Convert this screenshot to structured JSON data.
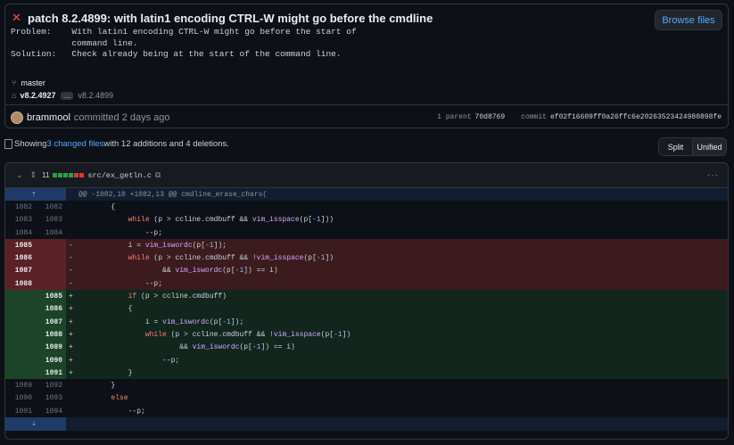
{
  "commit": {
    "title": "patch 8.2.4899: with latin1 encoding CTRL-W might go before the cmdline",
    "browse_label": "Browse files",
    "description": "Problem:    With latin1 encoding CTRL-W might go before the start of\n            command line.\nSolution:   Check already being at the start of the command line.",
    "branch": "master",
    "tag": "v8.2.4927",
    "ellipsis": "…",
    "tag_muted": "v8.2.4899",
    "author": "brammool",
    "committed": "committed 2 days ago",
    "parent_label": "1 parent",
    "parent_hash": "70d8769",
    "commit_label": "commit",
    "commit_hash": "ef02f16609ff0a26ffc6e20263523424980898fe"
  },
  "summary": {
    "prefix": "Showing ",
    "link": "3 changed files",
    "suffix": " with 12 additions and 4 deletions."
  },
  "view": {
    "split": "Split",
    "unified": "Unified"
  },
  "file": {
    "count": "11",
    "name": "src/ex_getln.c",
    "diffstat": [
      "add",
      "add",
      "add",
      "add",
      "del",
      "del"
    ],
    "lines": [
      {
        "type": "hunk",
        "a": "",
        "b": "",
        "code": "@@ -1082,10 +1082,13 @@ cmdline_erase_chars("
      },
      {
        "type": "ctx",
        "a": "1082",
        "b": "1082",
        "code": "        {"
      },
      {
        "type": "ctx",
        "a": "1083",
        "b": "1083",
        "code": "            while (p > ccline.cmdbuff && vim_isspace(p[-1]))"
      },
      {
        "type": "ctx",
        "a": "1084",
        "b": "1084",
        "code": "                --p;"
      },
      {
        "type": "del",
        "a": "1085",
        "b": "",
        "code": "            i = vim_iswordc(p[-1]);"
      },
      {
        "type": "del",
        "a": "1086",
        "b": "",
        "code": "            while (p > ccline.cmdbuff && !vim_isspace(p[-1])"
      },
      {
        "type": "del",
        "a": "1087",
        "b": "",
        "code": "                    && vim_iswordc(p[-1]) == i)"
      },
      {
        "type": "del",
        "a": "1088",
        "b": "",
        "code": "                --p;"
      },
      {
        "type": "add",
        "a": "",
        "b": "1085",
        "code": "            if (p > ccline.cmdbuff)"
      },
      {
        "type": "add",
        "a": "",
        "b": "1086",
        "code": "            {"
      },
      {
        "type": "add",
        "a": "",
        "b": "1087",
        "code": "                i = vim_iswordc(p[-1]);"
      },
      {
        "type": "add",
        "a": "",
        "b": "1088",
        "code": "                while (p > ccline.cmdbuff && !vim_isspace(p[-1])"
      },
      {
        "type": "add",
        "a": "",
        "b": "1089",
        "code": "                        && vim_iswordc(p[-1]) == i)"
      },
      {
        "type": "add",
        "a": "",
        "b": "1090",
        "code": "                    --p;"
      },
      {
        "type": "add",
        "a": "",
        "b": "1091",
        "code": "            }"
      },
      {
        "type": "ctx",
        "a": "1089",
        "b": "1092",
        "code": "        }"
      },
      {
        "type": "ctx",
        "a": "1090",
        "b": "1093",
        "code": "        else"
      },
      {
        "type": "ctx",
        "a": "1091",
        "b": "1094",
        "code": "            --p;"
      },
      {
        "type": "foot",
        "a": "",
        "b": "",
        "code": ""
      }
    ]
  },
  "colors": {
    "deleted_bg": "#3b1b1d",
    "added_bg": "#12261e",
    "link": "#58a6ff"
  }
}
